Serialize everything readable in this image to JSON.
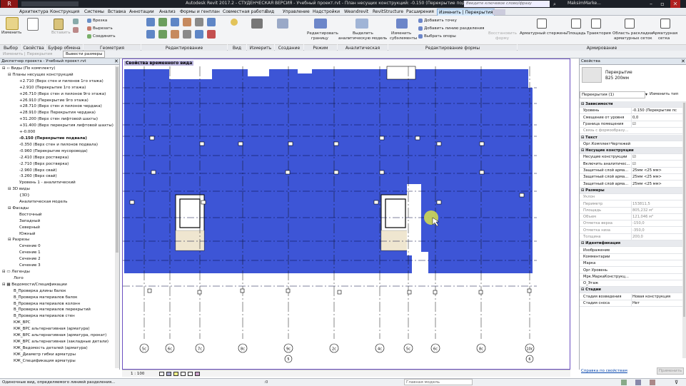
{
  "titlebar": {
    "app_button": "R",
    "title": "Autodesk Revit 2017.2 - СТУДЕНЧЕСКАЯ ВЕРСИЯ -    Учебный проект.rvt - План несущих конструкций: -0.150 (Перекрытие подвала)",
    "search_placeholder": "Введите ключевое слово/фразу",
    "user": "MaksimMarke..."
  },
  "tabs": [
    "Архитектура",
    "Конструкция",
    "Системы",
    "Вставка",
    "Аннотации",
    "Анализ",
    "Формы и генплан",
    "Совместная работа",
    "Вид",
    "Управление",
    "Надстройки",
    "Weandrevit",
    "RevitStructure",
    "Расширения",
    "Изменить | Перекрытия"
  ],
  "ribbon": {
    "select_button": "Изменить",
    "panels": [
      "Выбор",
      "Свойства",
      "Буфер обмена",
      "Геометрия",
      "Редактирование",
      "Вид",
      "Измерить",
      "Создание",
      "Режим",
      "Аналитическая модель",
      "Редактирование формы",
      "Армирование"
    ],
    "clipboard": [
      "Вставить"
    ],
    "geometry": [
      "Врезка",
      "Вырезать",
      "Соединить"
    ],
    "mode": [
      "Редактировать",
      "границу"
    ],
    "analytical": [
      "Выделить",
      "аналитическую модель"
    ],
    "shape": [
      "Изменить",
      "субэлементы",
      "Добавить точку",
      "Добавить линию разделения",
      "Выбрать опоры",
      "Восстановить",
      "форму"
    ],
    "reinforcement": [
      "Арматурный стержень",
      "Площадь",
      "Траектория",
      "Область раскладки",
      "арматурных сеток",
      "Арматурная",
      "сетка"
    ]
  },
  "optionbar": {
    "modify_label": "Изменить | Перекрытия",
    "button": "Вывести размеры"
  },
  "project_browser": {
    "title": "Диспетчер проекта - Учебный проект.rvt",
    "items": [
      {
        "text": "⊟ ‹› Виды (По комплекту)",
        "indent": 0
      },
      {
        "text": "⊟ Планы несущих конструкций",
        "indent": 1
      },
      {
        "text": "+2.710 (Верх стен и пилонов 1го этажа)",
        "indent": 3
      },
      {
        "text": "+2.910 (Перекрытие 1го этажа)",
        "indent": 3
      },
      {
        "text": "+26.710 (Верх стен и пилонов 9го этажа)",
        "indent": 3
      },
      {
        "text": "+26.910 (Перекрытие 9го этажа)",
        "indent": 3
      },
      {
        "text": "+28.710 (Верх стен и пилонов чердака)",
        "indent": 3
      },
      {
        "text": "+28.910 (Верх Перекрытия чердака)",
        "indent": 3
      },
      {
        "text": "+31.200 (Верх стен лифтовой шахты)",
        "indent": 3
      },
      {
        "text": "+31.400 (Верх перекрытия лифтовой шахты)",
        "indent": 3
      },
      {
        "text": "+-0.000",
        "indent": 3
      },
      {
        "text": "-0.150 (Перекрытие подвала)",
        "indent": 3,
        "bold": true
      },
      {
        "text": "-0.350 (Верх стен и пилонов подвала)",
        "indent": 3
      },
      {
        "text": "-0.960 (Перекрытие мусоровода)",
        "indent": 3
      },
      {
        "text": "-2.410 (Верх ростверка)",
        "indent": 3
      },
      {
        "text": "-2.710 (Верх ростверка)",
        "indent": 3
      },
      {
        "text": "-2.960 (Верх свай)",
        "indent": 3
      },
      {
        "text": "-3.260 (Верх свай)",
        "indent": 3
      },
      {
        "text": "Уровень 1 - аналитический",
        "indent": 3
      },
      {
        "text": "⊟ 3D виды",
        "indent": 1
      },
      {
        "text": "{3D}",
        "indent": 3
      },
      {
        "text": "Аналитическая модель",
        "indent": 3
      },
      {
        "text": "⊟ Фасады",
        "indent": 1
      },
      {
        "text": "Восточный",
        "indent": 3
      },
      {
        "text": "Западный",
        "indent": 3
      },
      {
        "text": "Северный",
        "indent": 3
      },
      {
        "text": "Южный",
        "indent": 3
      },
      {
        "text": "⊟ Разрезы",
        "indent": 1
      },
      {
        "text": "Сечение 0",
        "indent": 3
      },
      {
        "text": "Сечение 1",
        "indent": 3
      },
      {
        "text": "Сечение 2",
        "indent": 3
      },
      {
        "text": "Сечение 3",
        "indent": 3
      },
      {
        "text": "⊟ ▭ Легенды",
        "indent": 0
      },
      {
        "text": "Лого",
        "indent": 2
      },
      {
        "text": "⊟ ▦ Ведомости/Спецификации",
        "indent": 0
      },
      {
        "text": "В_Проверка длины балок",
        "indent": 2
      },
      {
        "text": "В_Проверка материалов балок",
        "indent": 2
      },
      {
        "text": "В_Проверка материалов колонн",
        "indent": 2
      },
      {
        "text": "В_Проверка материалов перекрытий",
        "indent": 2
      },
      {
        "text": "В_Проверка материалов стен",
        "indent": 2
      },
      {
        "text": "КЖ_ВРС",
        "indent": 2
      },
      {
        "text": "КЖ_ВРС альтернативная (арматура)",
        "indent": 2
      },
      {
        "text": "КЖ_ВРС альтернативная (арматура, прокат)",
        "indent": 2
      },
      {
        "text": "КЖ_ВРС альтернативная (закладные детали)",
        "indent": 2
      },
      {
        "text": "КЖ_Ведомость деталей (арматура)",
        "indent": 2
      },
      {
        "text": "КЖ_Диаметр гибки арматуры",
        "indent": 2
      },
      {
        "text": "КЖ_Спецификация арматуры",
        "indent": 2
      }
    ]
  },
  "view": {
    "title": "Свойства временного вида",
    "scale": "1 : 100",
    "grid_labels": [
      "5с",
      "6с",
      "7с",
      "8с",
      "9с",
      "2с",
      "4с",
      "5с",
      "6с",
      "8с",
      "10с"
    ],
    "grid_numbers": [
      "5",
      "6"
    ],
    "fill_color": "#3d55d6"
  },
  "properties": {
    "title": "Свойства",
    "type_name": "Перекрытие",
    "type_sub": "В25 200мм",
    "instance_selector": "Перекрытия (1)",
    "edit_type": "Изменить тип",
    "rows": [
      {
        "sec": "Зависимости"
      },
      {
        "k": "Уровень",
        "v": "-0.150 (Перекрытие пс"
      },
      {
        "k": "Смещение от уровня",
        "v": "0,0"
      },
      {
        "k": "Граница помещения",
        "v": "☑"
      },
      {
        "k": "Связь с формообразу...",
        "v": "",
        "grey": true
      },
      {
        "sec": "Текст"
      },
      {
        "k": "Орг.КомплектЧертежей",
        "v": ""
      },
      {
        "sec": "Несущие конструкции"
      },
      {
        "k": "Несущие конструкции",
        "v": "☑"
      },
      {
        "k": "Включить аналитичес...",
        "v": "☑"
      },
      {
        "k": "Защитный слой арма...",
        "v": "25мм <25 мм>"
      },
      {
        "k": "Защитный слой арма...",
        "v": "25мм <25 мм>"
      },
      {
        "k": "Защитный слой арма...",
        "v": "25мм <25 мм>"
      },
      {
        "sec": "Размеры"
      },
      {
        "k": "Уклон",
        "v": "",
        "grey": true
      },
      {
        "k": "Периметр",
        "v": "153811,5",
        "grey": true
      },
      {
        "k": "Площадь",
        "v": "805,232 м²",
        "grey": true
      },
      {
        "k": "Объем",
        "v": "121,046 м³",
        "grey": true
      },
      {
        "k": "Отметка верха",
        "v": "-150,0",
        "grey": true
      },
      {
        "k": "Отметка низа",
        "v": "-350,0",
        "grey": true
      },
      {
        "k": "Толщина",
        "v": "200,0",
        "grey": true
      },
      {
        "sec": "Идентификация"
      },
      {
        "k": "Изображение",
        "v": ""
      },
      {
        "k": "Комментарии",
        "v": ""
      },
      {
        "k": "Марка",
        "v": ""
      },
      {
        "k": "Орг.Уровень",
        "v": ""
      },
      {
        "k": "Мрк.МаркаКонструкц...",
        "v": ""
      },
      {
        "k": "О_Этаж",
        "v": ""
      },
      {
        "sec": "Стадии"
      },
      {
        "k": "Стадия возведения",
        "v": "Новая конструкция"
      },
      {
        "k": "Стадия сноса",
        "v": "Нет"
      }
    ],
    "help_link": "Справка по свойствам",
    "apply_button": "Применить"
  },
  "statusbar": {
    "text": "Одиночные вид, определяемого линией разделения...",
    "model": "Главная модель",
    "counter": ":0"
  }
}
